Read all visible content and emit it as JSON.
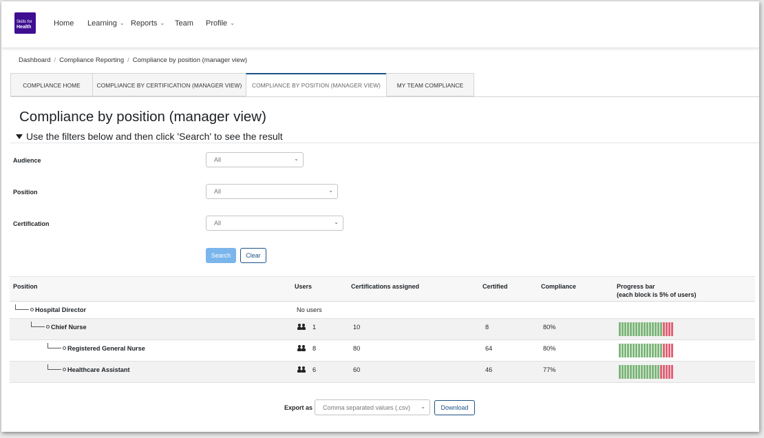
{
  "logo": {
    "line1": "Skills for",
    "line2": "Health"
  },
  "nav": [
    {
      "label": "Home",
      "dropdown": false
    },
    {
      "label": "Learning",
      "dropdown": true
    },
    {
      "label": "Reports",
      "dropdown": true
    },
    {
      "label": "Team",
      "dropdown": false
    },
    {
      "label": "Profile",
      "dropdown": true
    }
  ],
  "breadcrumb": [
    "Dashboard",
    "Compliance Reporting",
    "Compliance by position (manager view)"
  ],
  "tabs": [
    {
      "label": "COMPLIANCE HOME",
      "active": false
    },
    {
      "label": "COMPLIANCE BY CERTIFICATION (MANAGER VIEW)",
      "active": false
    },
    {
      "label": "COMPLIANCE BY POSITION (MANAGER VIEW)",
      "active": true
    },
    {
      "label": "MY TEAM COMPLIANCE",
      "active": false
    }
  ],
  "page_title": "Compliance by position (manager view)",
  "filter_heading": "Use the filters below and then click 'Search' to see the result",
  "filters": [
    {
      "label": "Audience",
      "value": "All"
    },
    {
      "label": "Position",
      "value": "All"
    },
    {
      "label": "Certification",
      "value": "All"
    }
  ],
  "buttons": {
    "search": "Search",
    "clear": "Clear",
    "download": "Download"
  },
  "table": {
    "headers": {
      "position": "Position",
      "users": "Users",
      "certs": "Certifications assigned",
      "certified": "Certified",
      "compliance": "Compliance",
      "progress_line1": "Progress bar",
      "progress_line2": "(each block is 5% of users)"
    },
    "rows": [
      {
        "position": "Hospital Director",
        "users": "",
        "no_users": "No users",
        "certs": "",
        "certified": "",
        "compliance": "",
        "green_blocks": 0
      },
      {
        "position": "Chief Nurse",
        "users": "1",
        "no_users": "",
        "certs": "10",
        "certified": "8",
        "compliance": "80%",
        "green_blocks": 16
      },
      {
        "position": "Registered General Nurse",
        "users": "8",
        "no_users": "",
        "certs": "80",
        "certified": "64",
        "compliance": "80%",
        "green_blocks": 16
      },
      {
        "position": "Healthcare Assistant",
        "users": "6",
        "no_users": "",
        "certs": "60",
        "certified": "46",
        "compliance": "77%",
        "green_blocks": 15
      }
    ]
  },
  "export": {
    "label": "Export as",
    "value": "Comma separated values (.csv)"
  },
  "colors": {
    "brand": "#3e0f91",
    "accent": "#1a5186",
    "compliant": "#7db77a",
    "noncompliant": "#e06377"
  }
}
